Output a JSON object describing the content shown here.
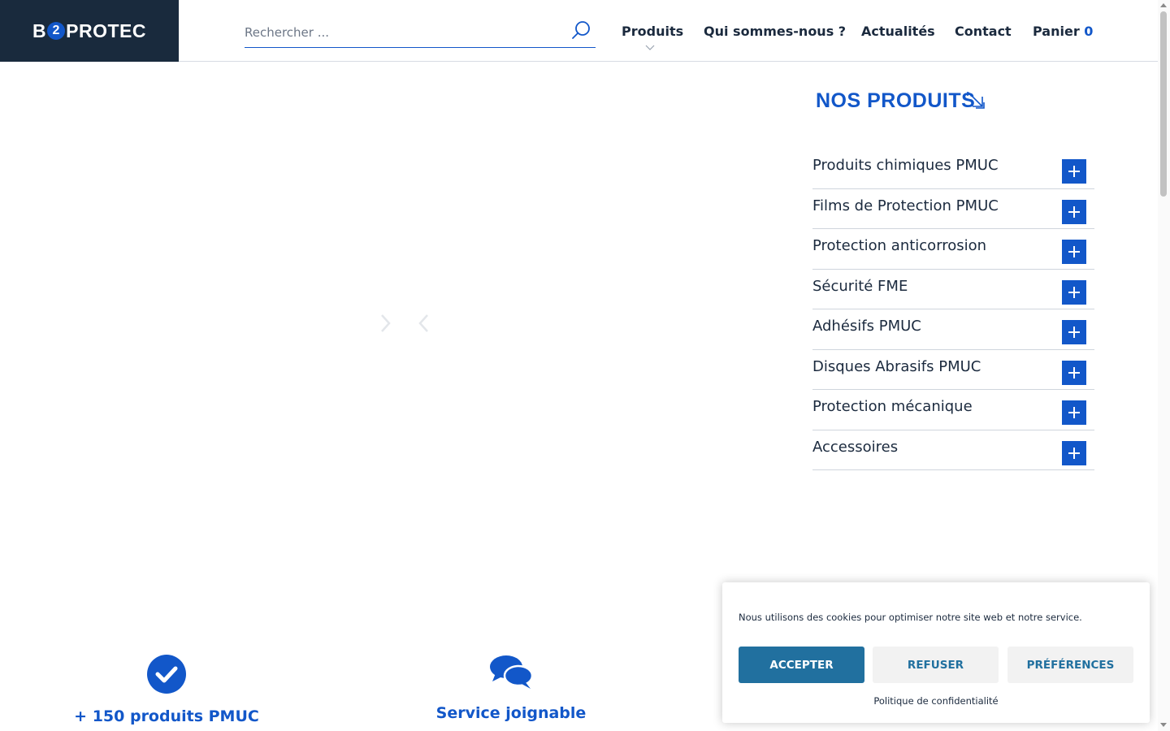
{
  "header": {
    "logo": {
      "prefix": "B",
      "mid": "2",
      "suffix": "PROTEC"
    },
    "search": {
      "placeholder": "Rechercher ..."
    },
    "nav": {
      "produits": "Produits",
      "qui": "Qui sommes-nous ?",
      "actualites": "Actualités",
      "contact": "Contact",
      "panier": "Panier",
      "panier_count": "0"
    }
  },
  "products": {
    "title": "NOS PRODUITS",
    "categories": [
      {
        "label": "Produits chimiques PMUC"
      },
      {
        "label": "Films de Protection PMUC"
      },
      {
        "label": "Protection anticorrosion"
      },
      {
        "label": "Sécurité FME"
      },
      {
        "label": "Adhésifs PMUC"
      },
      {
        "label": "Disques Abrasifs PMUC"
      },
      {
        "label": "Protection mécanique"
      },
      {
        "label": "Accessoires"
      }
    ]
  },
  "features": [
    {
      "title": "+ 150 produits PMUC",
      "icon": "check-circle-icon"
    },
    {
      "title": "Service joignable",
      "icon": "chat-bubbles-icon"
    }
  ],
  "cookie": {
    "text": "Nous utilisons des cookies pour optimiser notre site web et notre service.",
    "accept": "ACCEPTER",
    "refuse": "REFUSER",
    "preferences": "PRÉFÉRENCES",
    "policy": "Politique de confidentialité"
  },
  "colors": {
    "accent": "#1257c9",
    "navy": "#192a3d",
    "cookie_button": "#21709f"
  }
}
